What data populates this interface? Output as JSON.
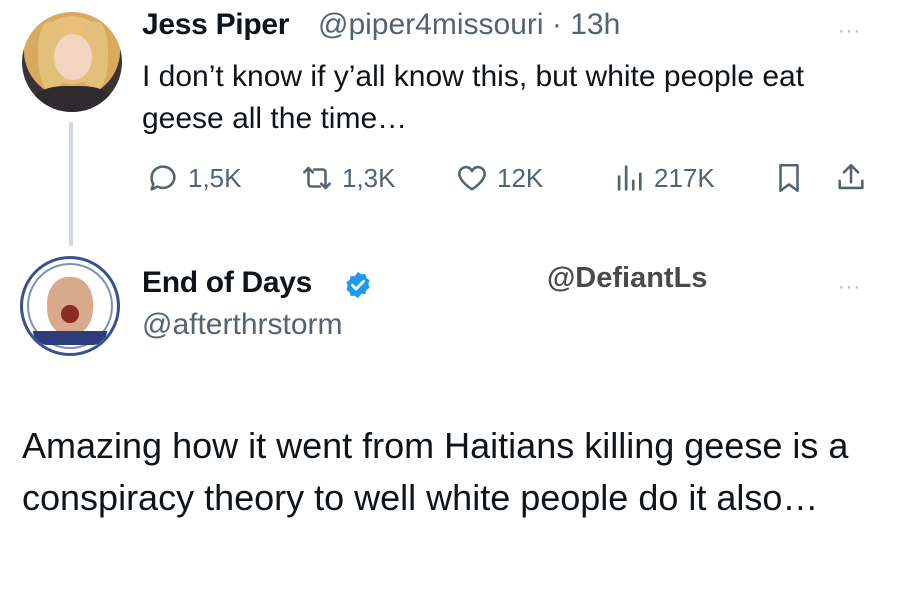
{
  "tweet1": {
    "name": "Jess Piper",
    "handle": "@piper4missouri",
    "time": "13h",
    "text": "I don’t know if y’all know this, but white people eat geese all the time…",
    "more": "···",
    "actions": {
      "replies": "1,5K",
      "reposts": "1,3K",
      "likes": "12K",
      "views": "217K"
    },
    "icons": {
      "reply": "reply-icon",
      "repost": "repost-icon",
      "like": "heart-icon",
      "views": "views-icon",
      "bookmark": "bookmark-icon",
      "share": "share-icon"
    }
  },
  "tweet2": {
    "name": "End of Days",
    "handle": "@afterthrstorm",
    "verified_color": "#1d9bf0",
    "more": "···",
    "text": "Amazing how it went from Haitians killing geese is a conspiracy theory to well white people do it also…"
  },
  "watermark": "@DefiantLs",
  "colors": {
    "text": "#0f1419",
    "secondary": "#536471",
    "thread_line": "#cfd9de",
    "accent": "#1d9bf0"
  }
}
